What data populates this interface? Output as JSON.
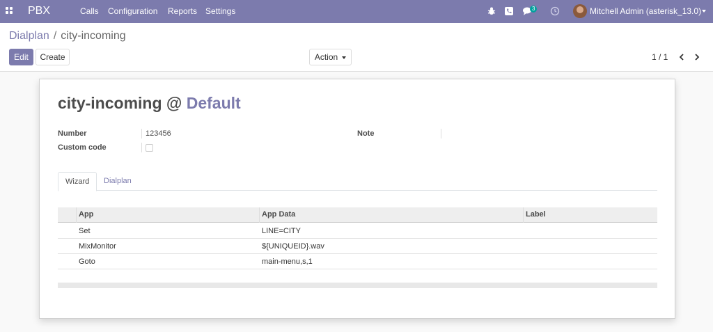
{
  "navbar": {
    "brand": "PBX",
    "menus": [
      "Calls",
      "Configuration",
      "Reports",
      "Settings"
    ],
    "message_count": "3",
    "user": "Mitchell Admin (asterisk_13.0)",
    "icons": [
      "apps-icon",
      "bug-icon",
      "phone-icon",
      "chat-icon",
      "clock-icon",
      "avatar"
    ]
  },
  "breadcrumb": {
    "parent": "Dialplan",
    "separator": "/",
    "current": "city-incoming"
  },
  "buttons": {
    "edit": "Edit",
    "create": "Create",
    "action": "Action"
  },
  "pager": {
    "value": "1 / 1"
  },
  "form": {
    "title_name": "city-incoming",
    "title_at": "@",
    "title_context": "Default",
    "fields": {
      "number_label": "Number",
      "number_value": "123456",
      "custom_code_label": "Custom code",
      "custom_code_checked": false,
      "note_label": "Note"
    },
    "tabs": [
      "Wizard",
      "Dialplan"
    ],
    "table": {
      "columns": [
        "App",
        "App Data",
        "Label"
      ],
      "rows": [
        {
          "app": "Set",
          "app_data": "LINE=CITY",
          "label": ""
        },
        {
          "app": "MixMonitor",
          "app_data": "${UNIQUEID}.wav",
          "label": ""
        },
        {
          "app": "Goto",
          "app_data": "main-menu,s,1",
          "label": ""
        }
      ]
    }
  },
  "colors": {
    "brand": "#7c7bad",
    "badge": "#00a09d"
  }
}
